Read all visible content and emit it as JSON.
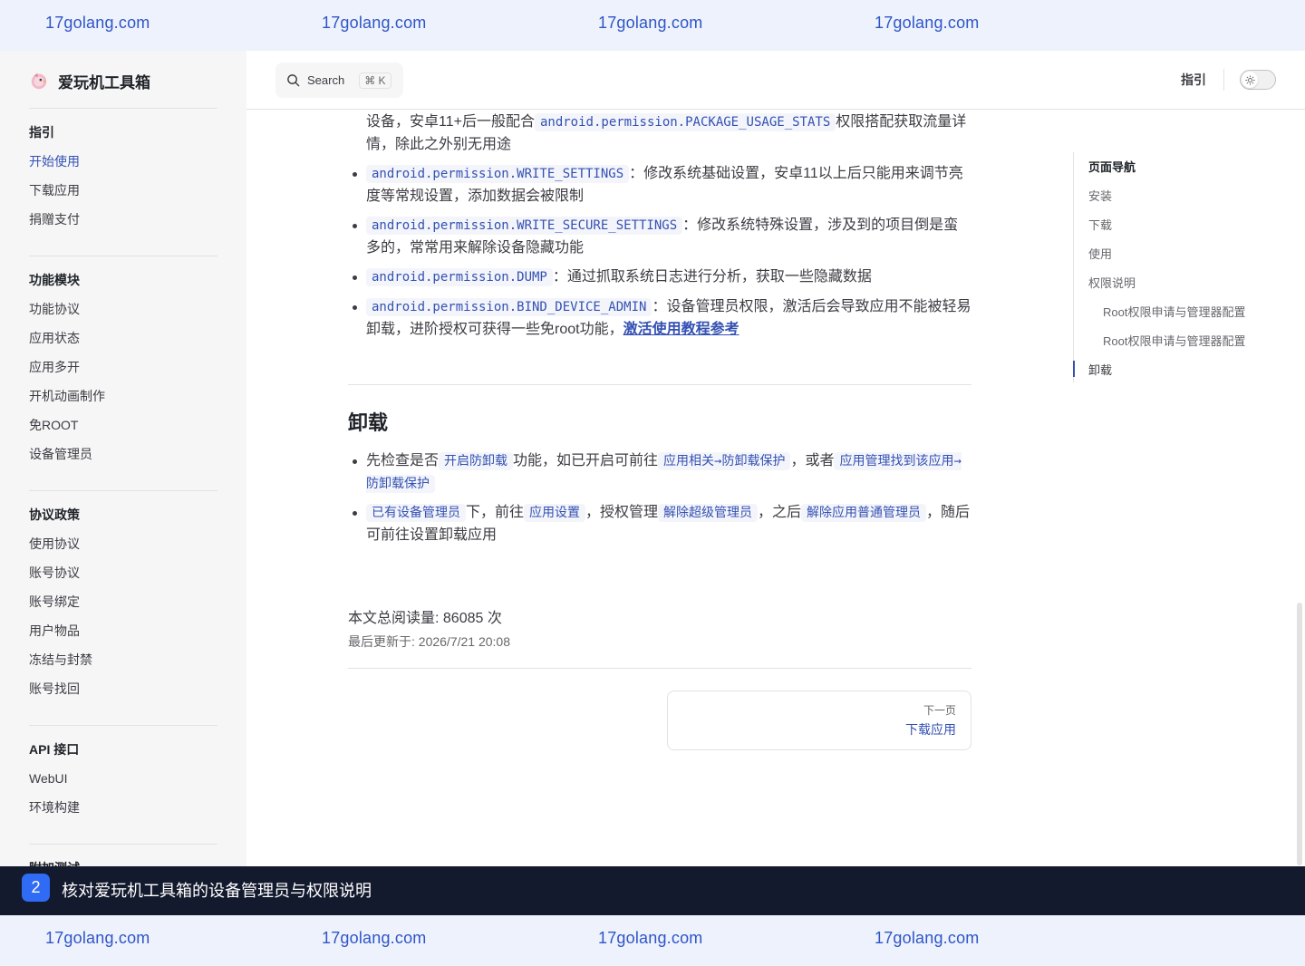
{
  "watermarks": [
    "17golang.com",
    "17golang.com",
    "17golang.com",
    "17golang.com"
  ],
  "brand": {
    "name": "爱玩机工具箱",
    "logo_icon": "bird-logo"
  },
  "sidebar": {
    "groups": [
      {
        "title": "指引",
        "items": [
          "开始使用",
          "下载应用",
          "捐赠支付"
        ],
        "active_index": 0
      },
      {
        "title": "功能模块",
        "items": [
          "功能协议",
          "应用状态",
          "应用多开",
          "开机动画制作",
          "免ROOT",
          "设备管理员"
        ]
      },
      {
        "title": "协议政策",
        "items": [
          "使用协议",
          "账号协议",
          "账号绑定",
          "用户物品",
          "冻结与封禁",
          "账号找回"
        ]
      },
      {
        "title": "API 接口",
        "items": [
          "WebUI",
          "环境构建"
        ]
      },
      {
        "title": "附加测试",
        "items": []
      }
    ]
  },
  "navbar": {
    "search": {
      "label": "Search",
      "shortcut": "⌘ K"
    },
    "link": "指引",
    "theme_icon": "sun-icon"
  },
  "content": {
    "permissions": [
      {
        "code": "",
        "lead": "设备，安卓11+后一般配合",
        "code_inline": "android.permission.PACKAGE_USAGE_STATS",
        "tail": "权限搭配获取流量详情，除此之外别无用途",
        "bullet": false
      },
      {
        "code": "android.permission.WRITE_SETTINGS",
        "text": "：修改系统基础设置，安卓11以上后只能用来调节亮度等常规设置，添加数据会被限制"
      },
      {
        "code": "android.permission.WRITE_SECURE_SETTINGS",
        "text": "：修改系统特殊设置，涉及到的项目倒是蛮多的，常常用来解除设备隐藏功能"
      },
      {
        "code": "android.permission.DUMP",
        "text": "：通过抓取系统日志进行分析，获取一些隐藏数据"
      },
      {
        "code": "android.permission.BIND_DEVICE_ADMIN",
        "text": "：设备管理员权限，激活后会导致应用不能被轻易卸载，进阶授权可获得一些免root功能，",
        "link": "激活使用教程参考"
      }
    ],
    "uninstall": {
      "heading": "卸载",
      "step1": {
        "a": "先检查是否",
        "tag1": "开启防卸载",
        "b": "功能，如已开启可前往",
        "tag2": "应用相关→防卸载保护",
        "c": "，或者",
        "tag3": "应用管理找到该应用→防卸载保护"
      },
      "step2": {
        "tag1": "已有设备管理员",
        "a": "下，前往",
        "tag2": "应用设置",
        "b": "，授权管理",
        "tag3": "解除超级管理员",
        "c": "，之后",
        "tag4": "解除应用普通管理员",
        "d": "，随后可前往设置卸载应用"
      }
    },
    "read_count": "本文总阅读量: 86085 次",
    "last_updated": "最后更新于: 2026/7/21 20:08",
    "next": {
      "desc": "下一页",
      "title": "下载应用"
    }
  },
  "outline": {
    "title": "页面导航",
    "items": [
      {
        "label": "安装",
        "level": 1
      },
      {
        "label": "下载",
        "level": 1
      },
      {
        "label": "使用",
        "level": 1
      },
      {
        "label": "权限说明",
        "level": 1
      },
      {
        "label": "Root权限申请与管理器配置",
        "level": 2
      },
      {
        "label": "Root权限申请与管理器配置",
        "level": 2
      },
      {
        "label": "卸载",
        "level": 1
      }
    ]
  },
  "banner": {
    "step": "2",
    "text": "核对爱玩机工具箱的设备管理员与权限说明"
  }
}
